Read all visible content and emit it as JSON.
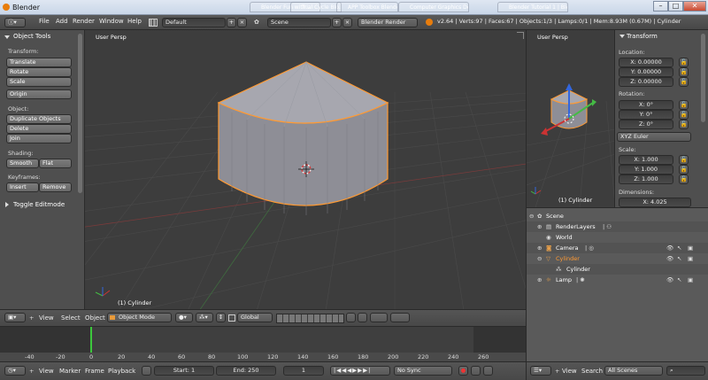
{
  "window": {
    "title": "Blender",
    "tabs": [
      "Blender Fun with...",
      "Trial Cycle Blo...",
      "APP Toolbox Blender...",
      "Computer Graphics Dev...",
      "Blender Tutorial 1 | Blend..."
    ],
    "minimize": "–",
    "maximize": "□",
    "close": "✕"
  },
  "info_bar": {
    "menus": [
      "File",
      "Add",
      "Render",
      "Window",
      "Help"
    ],
    "layout": "Default",
    "scene": "Scene",
    "engine": "Blender Render",
    "stats": "v2.64 | Verts:97 | Faces:67 | Objects:1/3 | Lamps:0/1 | Mem:8.93M (0.67M) | Cylinder"
  },
  "toolshelf": {
    "title": "Object Tools",
    "transform_label": "Transform:",
    "translate": "Translate",
    "rotate": "Rotate",
    "scale": "Scale",
    "origin": "Origin",
    "object_label": "Object:",
    "duplicate": "Duplicate Objects",
    "delete": "Delete",
    "join": "Join",
    "shading_label": "Shading:",
    "smooth": "Smooth",
    "flat": "Flat",
    "keyframes_label": "Keyframes:",
    "insert": "Insert",
    "remove": "Remove",
    "toggle_editmode": "Toggle Editmode"
  },
  "viewport": {
    "label": "User Persp",
    "object_name": "(1) Cylinder"
  },
  "viewport_header": {
    "menus": [
      "View",
      "Select",
      "Object"
    ],
    "mode": "Object Mode",
    "orientation": "Global"
  },
  "timeline": {
    "ticks": [
      "-40",
      "-20",
      "0",
      "20",
      "40",
      "60",
      "80",
      "100",
      "120",
      "140",
      "160",
      "180",
      "200",
      "220",
      "240",
      "260"
    ],
    "current_frame_value": 1,
    "menus": [
      "View",
      "Marker",
      "Frame",
      "Playback"
    ],
    "start": "Start: 1",
    "end": "End: 250",
    "current": "1",
    "sync": "No Sync"
  },
  "mini_view": {
    "label": "User Persp",
    "object_name": "(1) Cylinder"
  },
  "properties": {
    "title": "Transform",
    "location_label": "Location:",
    "loc_x": "X: 0.00000",
    "loc_y": "Y: 0.00000",
    "loc_z": "Z: 0.00000",
    "rotation_label": "Rotation:",
    "rot_x": "X: 0°",
    "rot_y": "Y: 0°",
    "rot_z": "Z: 0°",
    "rotation_mode": "XYZ Euler",
    "scale_label": "Scale:",
    "scale_x": "X: 1.000",
    "scale_y": "Y: 1.000",
    "scale_z": "Z: 1.000",
    "dimensions_label": "Dimensions:",
    "dim_x": "X: 4.025"
  },
  "outliner": {
    "items": [
      "Scene",
      "RenderLayers",
      "World",
      "Camera",
      "Cylinder",
      "Cylinder",
      "Lamp"
    ]
  },
  "outliner_header": {
    "menus": [
      "View",
      "Search"
    ],
    "filter": "All Scenes"
  },
  "colors": {
    "selection_outline": "#ff9a33",
    "timeline_cursor": "#3cc83c",
    "axis_red": "#cc3333",
    "axis_green": "#44bb44",
    "axis_blue": "#3366dd"
  }
}
